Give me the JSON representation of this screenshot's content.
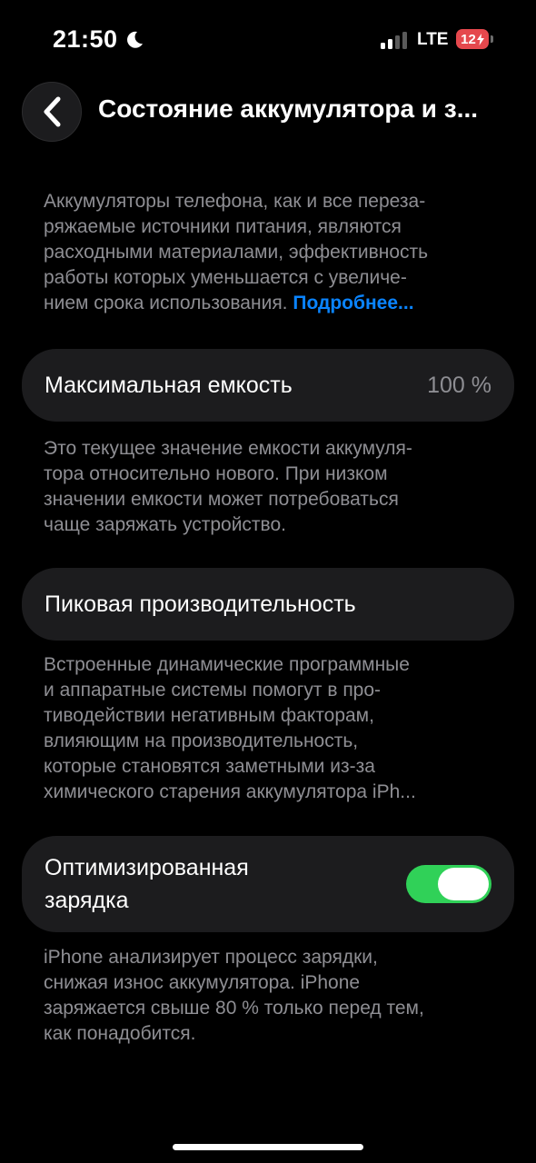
{
  "status_bar": {
    "time": "21:50",
    "network": "LTE",
    "battery_level": "12",
    "battery_color": "#e5484d",
    "icons": [
      "moon-icon",
      "signal-icon",
      "battery-icon"
    ]
  },
  "header": {
    "back_icon": "chevron-left-icon",
    "title": "Состояние аккумулятора и з..."
  },
  "intro": {
    "text_lines": [
      "Аккумуляторы телефона, как и все переза-",
      "ряжаемые источники питания, являются",
      "расходными материалами, эффективность",
      "работы которых уменьшается с увеличе-",
      "нием срока использования."
    ],
    "link_label": "Подробнее...",
    "link_color": "#0a84ff"
  },
  "max_capacity": {
    "label": "Максимальная емкость",
    "value": "100 %",
    "description_lines": [
      "Это текущее значение емкости аккумуля-",
      "тора относительно нового. При низком",
      "значении емкости может потребоваться",
      "чаще заряжать устройство."
    ]
  },
  "peak_performance": {
    "label": "Пиковая производительность",
    "description_lines": [
      "Встроенные динамические программные",
      "и аппаратные системы помогут в про-",
      "тиводействии негативным факторам,",
      "влияющим на производительность,",
      "которые становятся заметными из-за",
      "химического старения аккумулятора iPh..."
    ]
  },
  "optimized_charging": {
    "label_lines": [
      "Оптимизированная",
      "зарядка"
    ],
    "enabled": true,
    "toggle_color": "#30d158",
    "description_lines": [
      "iPhone анализирует процесс зарядки,",
      "снижая износ аккумулятора. iPhone",
      "заряжается свыше 80 % только перед тем,",
      "как понадобится."
    ]
  }
}
